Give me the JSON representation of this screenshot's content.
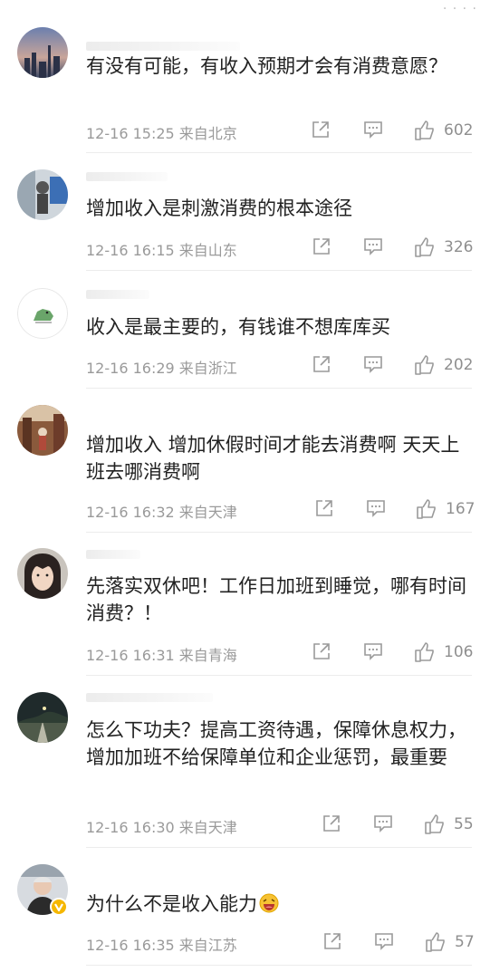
{
  "comments": [
    {
      "text": "有没有可能，有收入预期才会有消费意愿？",
      "time": "12-16 15:25",
      "location": "来自北京",
      "likes": "602",
      "avatar_icon": "city-sunset-avatar"
    },
    {
      "text": "增加收入是刺激消费的根本途径",
      "time": "12-16 16:15",
      "location": "来自山东",
      "likes": "326",
      "avatar_icon": "figure-avatar"
    },
    {
      "text": "收入是最主要的，有钱谁不想库库买",
      "time": "12-16 16:29",
      "location": "来自浙江",
      "likes": "202",
      "avatar_icon": "green-dinosaur-avatar"
    },
    {
      "text": "增加收入 增加休假时间才能去消费啊 天天上班去哪消费啊",
      "time": "12-16 16:32",
      "location": "来自天津",
      "likes": "167",
      "avatar_icon": "street-avatar"
    },
    {
      "text": "先落实双休吧！工作日加班到睡觉，哪有时间消费？！",
      "time": "12-16 16:31",
      "location": "来自青海",
      "likes": "106",
      "avatar_icon": "face-avatar"
    },
    {
      "text": "怎么下功夫？提高工资待遇，保障休息权力，增加加班不给保障单位和企业惩罚，最重要",
      "time": "12-16 16:30",
      "location": "来自天津",
      "likes": "55",
      "avatar_icon": "night-road-avatar"
    },
    {
      "text": "为什么不是收入能力",
      "time": "12-16 16:35",
      "location": "来自江苏",
      "likes": "57",
      "avatar_icon": "person-avatar",
      "emoji": "laughing-emoji"
    }
  ],
  "colors": {
    "meta": "#9a9a9a",
    "text": "#222222",
    "verified": "#f5b700"
  }
}
